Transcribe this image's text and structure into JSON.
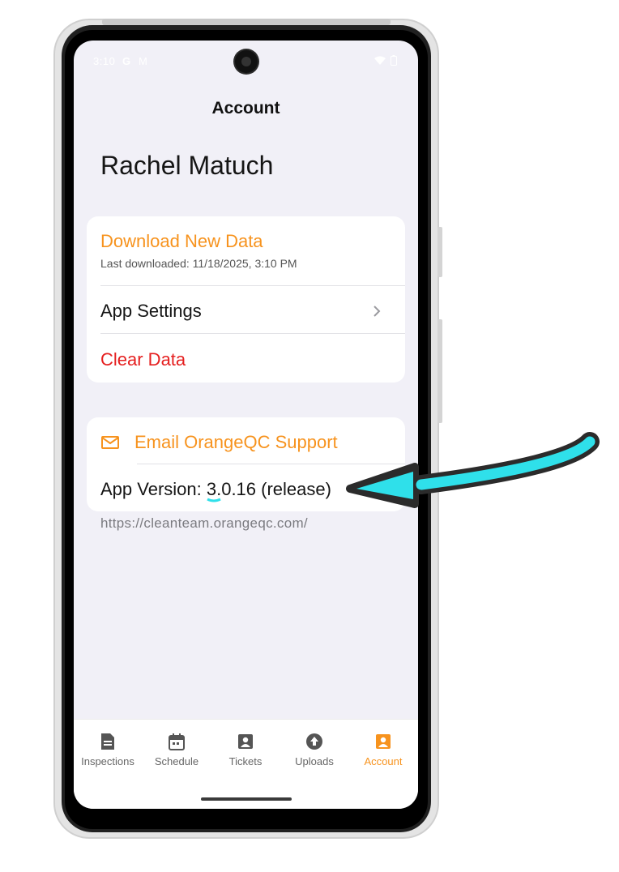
{
  "status_bar": {
    "time": "3:10",
    "extra_icons": [
      "G",
      "M"
    ],
    "right_icons": [
      "wifi-icon",
      "battery-icon"
    ]
  },
  "header": {
    "title": "Account"
  },
  "user": {
    "name": "Rachel Matuch"
  },
  "menu": {
    "download": {
      "label": "Download New Data",
      "sub": "Last downloaded: 11/18/2025, 3:10 PM"
    },
    "settings": {
      "label": "App Settings",
      "icon": "chevron-right-icon"
    },
    "clear": {
      "label": "Clear Data"
    }
  },
  "support": {
    "email_label": "Email OrangeQC Support",
    "email_icon": "mail-icon",
    "version_label": "App Version: 3.0.16 (release)"
  },
  "footer_url": "https://cleanteam.orangeqc.com/",
  "tabs": [
    {
      "label": "Inspections",
      "icon": "document-icon",
      "active": false
    },
    {
      "label": "Schedule",
      "icon": "calendar-icon",
      "active": false
    },
    {
      "label": "Tickets",
      "icon": "ticket-icon",
      "active": false
    },
    {
      "label": "Uploads",
      "icon": "upload-icon",
      "active": false
    },
    {
      "label": "Account",
      "icon": "account-icon",
      "active": true
    }
  ],
  "colors": {
    "accent": "#f7931e",
    "danger": "#e51f1f",
    "background": "#f1f0f7",
    "annotation_arrow": "#2fe0ea"
  },
  "annotation": {
    "type": "arrow",
    "target": "app-version-text"
  }
}
